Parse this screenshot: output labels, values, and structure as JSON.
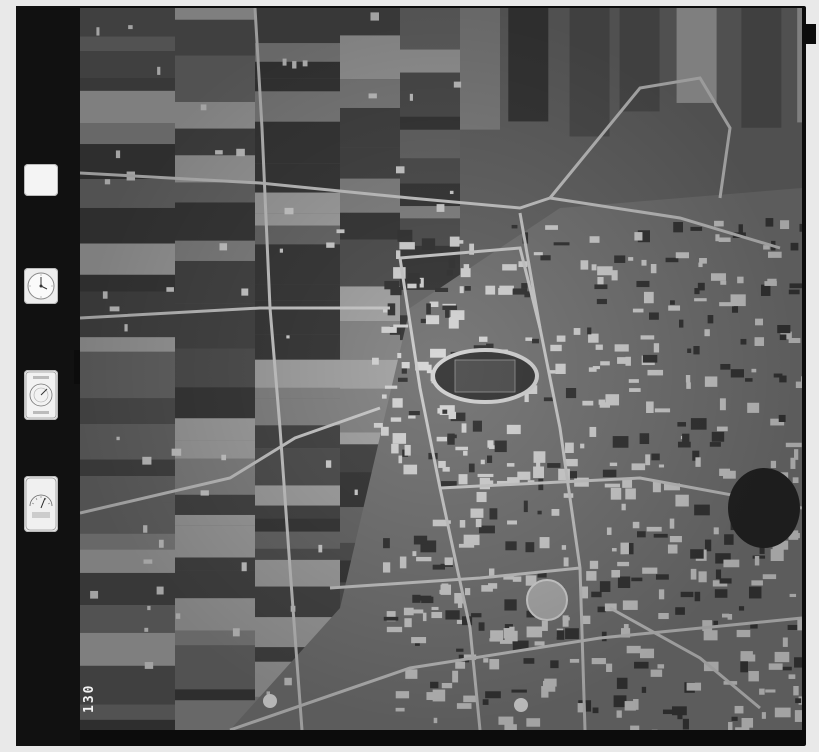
{
  "image": {
    "description_tag": "aerial-survey-photograph",
    "frame_number": "130",
    "colors": {
      "frame": "#0c0c0c",
      "field_dark": "#3d3d3d",
      "field_mid": "#6e6e6e",
      "field_light": "#a9a9a9",
      "road": "#cfcfcf",
      "roof": "#d9d9d9"
    }
  },
  "instruments": [
    {
      "name": "indicator-square-icon"
    },
    {
      "name": "clock-dial-icon"
    },
    {
      "name": "altimeter-dial-icon"
    },
    {
      "name": "level-bubble-icon"
    }
  ]
}
